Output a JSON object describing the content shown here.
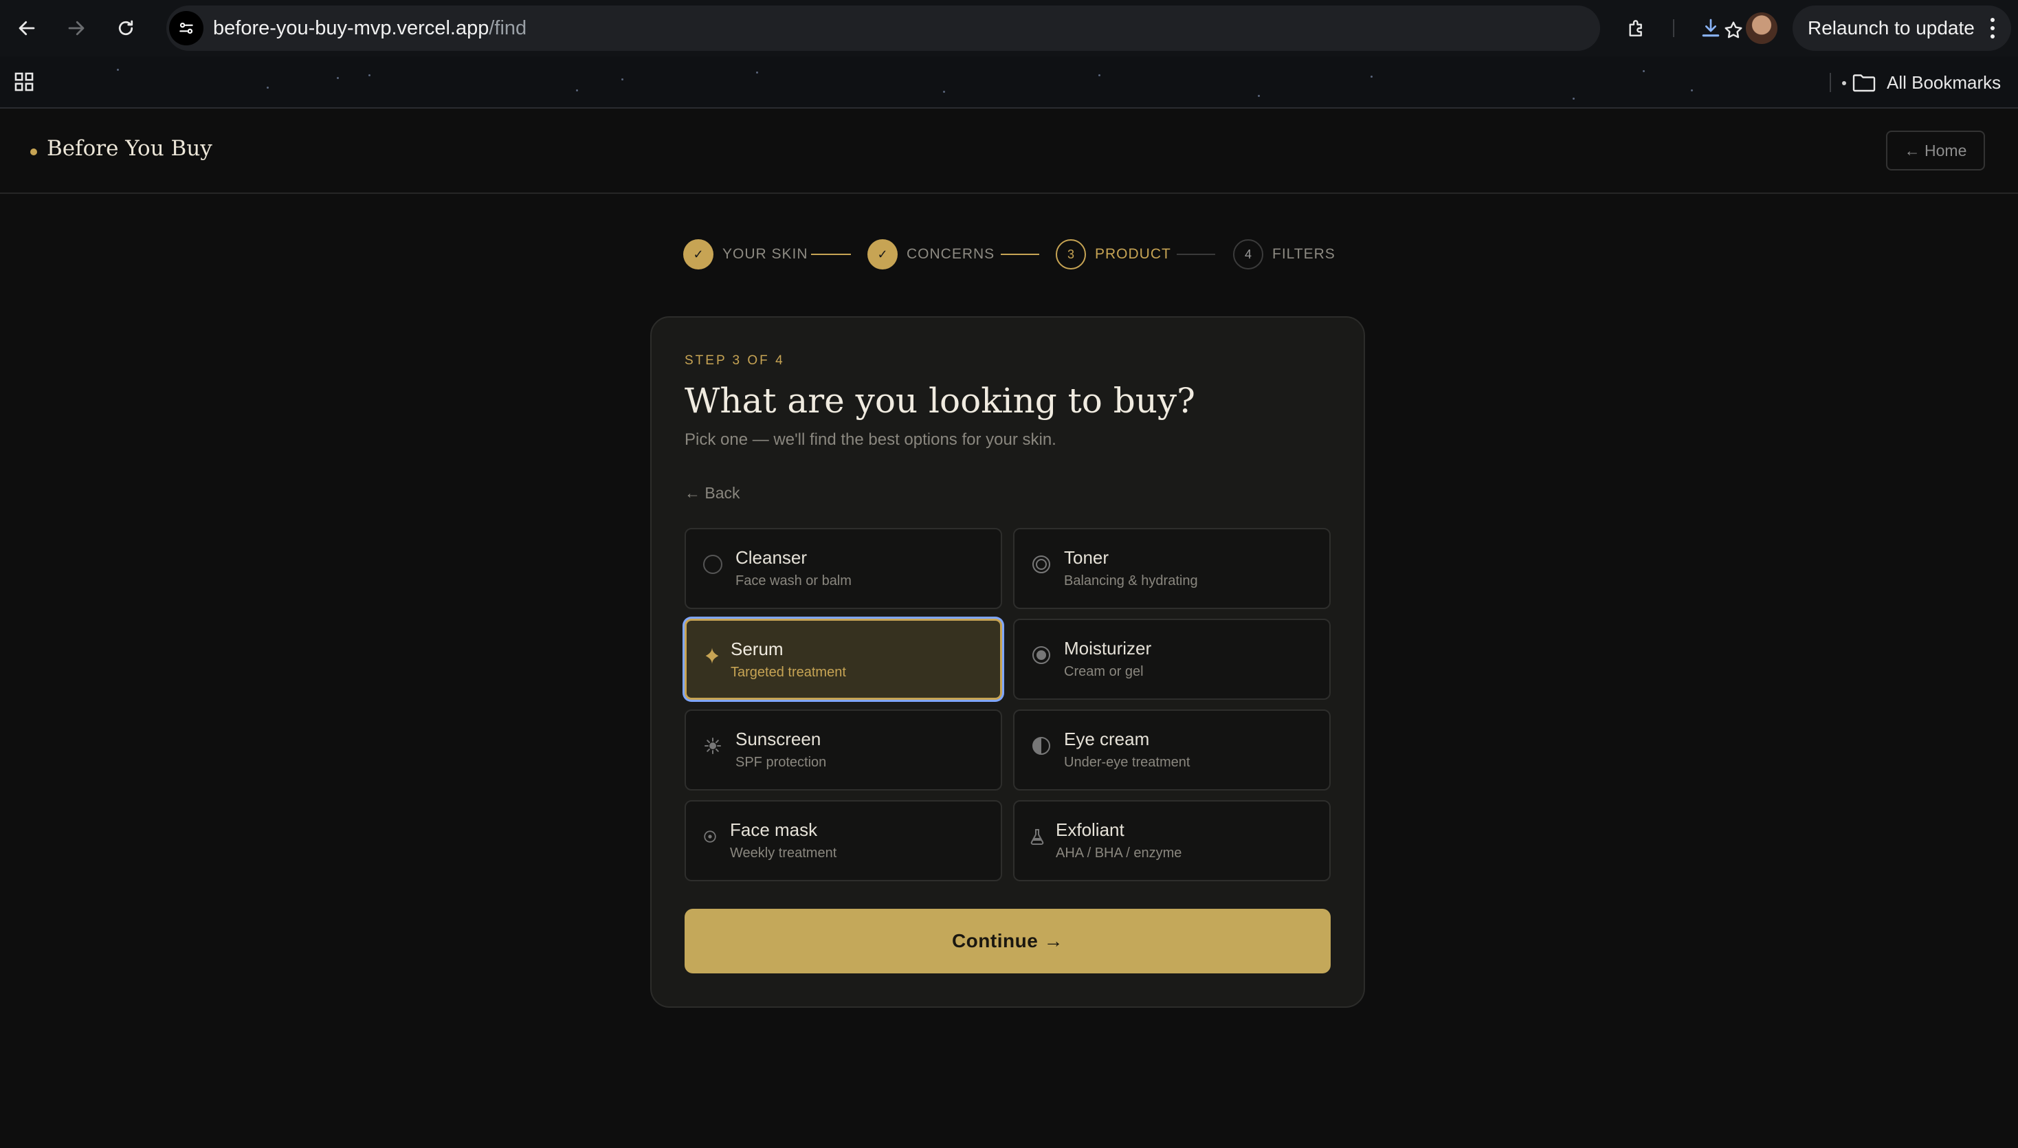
{
  "browser": {
    "url_host": "before-you-buy-mvp.vercel.app",
    "url_path": "/find",
    "relaunch_label": "Relaunch to update",
    "bookmarks_label": "All Bookmarks"
  },
  "header": {
    "brand": "Before You Buy",
    "home_label": "← Home"
  },
  "stepper": {
    "steps": [
      {
        "label": "YOUR SKIN",
        "marker": "✓",
        "state": "done"
      },
      {
        "label": "CONCERNS",
        "marker": "✓",
        "state": "done"
      },
      {
        "label": "PRODUCT",
        "marker": "3",
        "state": "active"
      },
      {
        "label": "FILTERS",
        "marker": "4",
        "state": "todo"
      }
    ]
  },
  "card": {
    "eyebrow": "STEP 3 OF 4",
    "title": "What are you looking to buy?",
    "subtitle": "Pick one — we'll find the best options for your skin.",
    "back_label": "← Back",
    "continue_label": "Continue →",
    "options": [
      {
        "title": "Cleanser",
        "subtitle": "Face wash or balm",
        "icon": "circle-outline-icon",
        "selected": false
      },
      {
        "title": "Toner",
        "subtitle": "Balancing & hydrating",
        "icon": "double-circle-icon",
        "selected": false
      },
      {
        "title": "Serum",
        "subtitle": "Targeted treatment",
        "icon": "sparkle-icon",
        "selected": true
      },
      {
        "title": "Moisturizer",
        "subtitle": "Cream or gel",
        "icon": "filled-circle-icon",
        "selected": false
      },
      {
        "title": "Sunscreen",
        "subtitle": "SPF protection",
        "icon": "sun-icon",
        "selected": false
      },
      {
        "title": "Eye cream",
        "subtitle": "Under-eye treatment",
        "icon": "half-circle-icon",
        "selected": false
      },
      {
        "title": "Face mask",
        "subtitle": "Weekly treatment",
        "icon": "dot-circle-icon",
        "selected": false
      },
      {
        "title": "Exfoliant",
        "subtitle": "AHA / BHA / enzyme",
        "icon": "flask-icon",
        "selected": false
      }
    ]
  },
  "colors": {
    "accent": "#c7a454",
    "button": "#c4a85a",
    "focus_ring": "#7fa6ff",
    "background": "#0e0e0e",
    "card": "#1a1a18"
  }
}
